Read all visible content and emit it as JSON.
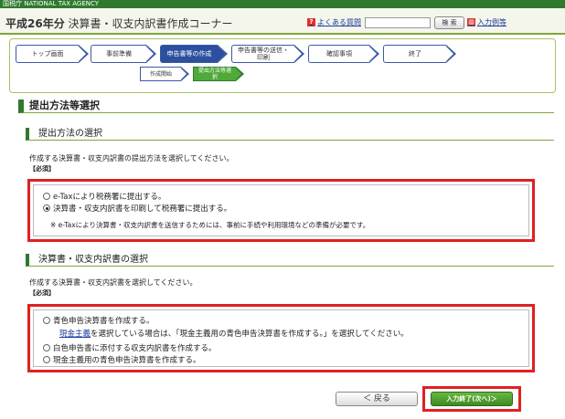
{
  "agency": "国税庁 NATIONAL TAX AGENCY",
  "header": {
    "title_year": "平成26年分",
    "title_rest": " 決算書・収支内訳書作成コーナー",
    "faq": "よくある質問",
    "search_button": "検 索",
    "help": "入力例等"
  },
  "steps": [
    "トップ画面",
    "事前準備",
    "申告書等の作成",
    "申告書等の送信・印刷",
    "確認事項",
    "終了"
  ],
  "substeps": [
    "作成開始",
    "提出方法等選択"
  ],
  "section_title": "提出方法等選択",
  "method": {
    "title": "提出方法の選択",
    "desc": "作成する決算書・収支内訳書の提出方法を選択してください。",
    "required": "【必須】",
    "options": [
      "e-Taxにより税務署に提出する。",
      "決算書・収支内訳書を印刷して税務署に提出する。"
    ],
    "note": "※ e-Taxにより決算書・収支内訳書を送信するためには、事前に手続や利用環境などの準備が必要です。"
  },
  "doc": {
    "title": "決算書・収支内訳書の選択",
    "desc": "作成する決算書・収支内訳書を選択してください。",
    "required": "【必須】",
    "option1": "青色申告決算書を作成する。",
    "note_link": "現金主義",
    "note_rest": "を選択している場合は、「現金主義用の青色申告決算書を作成する。」を選択してください。",
    "option2": "白色申告書に添付する収支内訳書を作成する。",
    "option3": "現金主義用の青色申告決算書を作成する。"
  },
  "buttons": {
    "back": "＜ 戻る",
    "next": "入力終了(次へ)＞"
  }
}
